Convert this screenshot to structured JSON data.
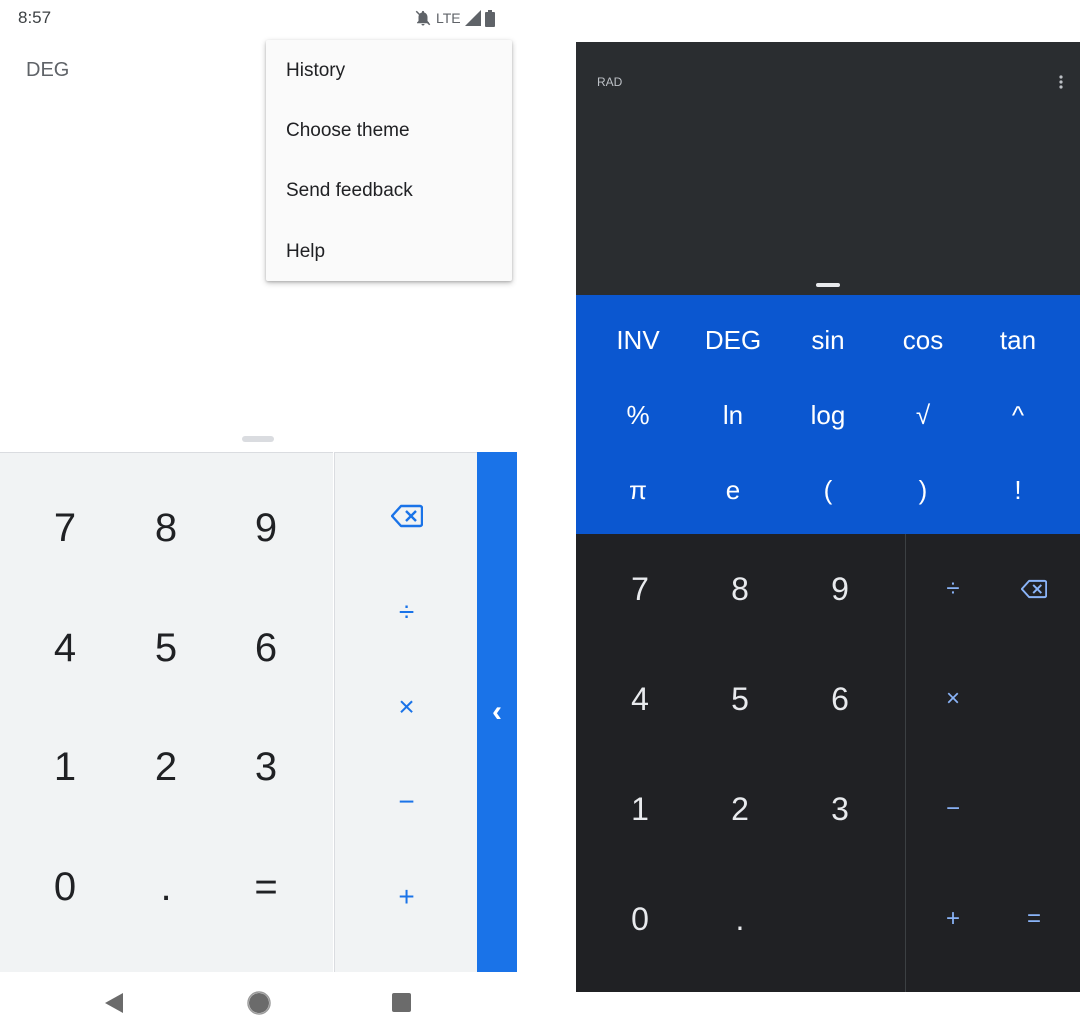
{
  "left_screen": {
    "status_bar": {
      "time": "8:57",
      "network": "LTE"
    },
    "mode": "DEG",
    "overflow_menu": {
      "items": [
        {
          "label": "History"
        },
        {
          "label": "Choose theme"
        },
        {
          "label": "Send feedback"
        },
        {
          "label": "Help"
        }
      ]
    },
    "keypad": {
      "rows": [
        [
          "7",
          "8",
          "9"
        ],
        [
          "4",
          "5",
          "6"
        ],
        [
          "1",
          "2",
          "3"
        ],
        [
          "0",
          ".",
          "="
        ]
      ]
    },
    "operators": {
      "divide": "÷",
      "multiply": "×",
      "minus": "−",
      "plus": "+"
    },
    "drawer_chevron": "‹",
    "accent_color": "#1a73e8",
    "icons": [
      "notifications-off-icon",
      "signal-icon",
      "battery-icon",
      "backspace-icon",
      "back-nav-icon",
      "home-nav-icon",
      "recents-nav-icon"
    ]
  },
  "right_screen": {
    "mode": "RAD",
    "scientific": {
      "rows": [
        [
          "INV",
          "DEG",
          "sin",
          "cos",
          "tan"
        ],
        [
          "%",
          "ln",
          "log",
          "√",
          "^"
        ],
        [
          "π",
          "e",
          "(",
          ")",
          "!"
        ]
      ]
    },
    "keypad": {
      "rows": [
        [
          "7",
          "8",
          "9"
        ],
        [
          "4",
          "5",
          "6"
        ],
        [
          "1",
          "2",
          "3"
        ],
        [
          "0",
          "."
        ]
      ]
    },
    "operators": {
      "divide": "÷",
      "multiply": "×",
      "minus": "−",
      "plus": "+",
      "equals": "="
    },
    "accent_color": "#0b57d0",
    "icons": [
      "more-vert-icon",
      "backspace-icon"
    ]
  }
}
